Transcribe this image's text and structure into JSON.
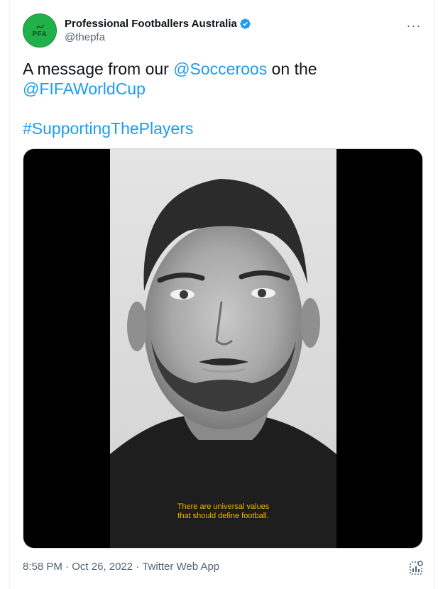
{
  "author": {
    "name": "Professional Footballers Australia",
    "handle": "@thepfa",
    "avatar_text": "PFA",
    "verified_icon": "verified-badge-icon"
  },
  "more_icon_glyph": "···",
  "tweet": {
    "line1_prefix": "A message from our ",
    "mention1": "@Socceroos",
    "line1_suffix": " on the",
    "mention2": "@FIFAWorldCup",
    "hashtag": "#SupportingThePlayers"
  },
  "video": {
    "caption_line1": "There are universal values",
    "caption_line2": "that should define football."
  },
  "meta": {
    "time": "8:58 PM",
    "separator": " · ",
    "date": "Oct 26, 2022",
    "source": "Twitter Web App"
  },
  "colors": {
    "link": "#1d9bf0",
    "secondary_text": "#536471",
    "caption": "#ffc400",
    "avatar_bg": "#21b14a"
  }
}
